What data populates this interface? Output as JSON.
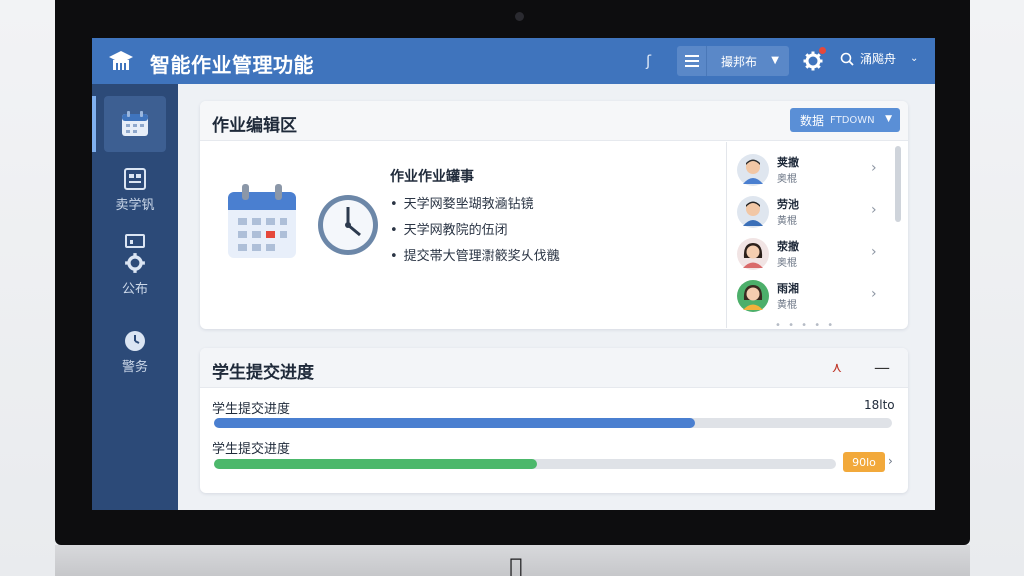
{
  "header": {
    "title": "智能作业管理功能",
    "separator_icon": "wave-icon",
    "filter_label": "撮邦布",
    "search_label": "涌飚舟",
    "accent_color": "#3f74bd"
  },
  "sidebar": {
    "items": [
      {
        "label": "",
        "icon": "calendar-icon"
      },
      {
        "label": "卖学钒",
        "icon": "grid-doc-icon"
      },
      {
        "label": "公布",
        "icon": "gear-icon"
      },
      {
        "label": "警务",
        "icon": "clock-icon"
      }
    ]
  },
  "editor": {
    "title": "作业编辑区",
    "data_button_label": "数据",
    "data_button_sub": "FTDOWN",
    "task_title": "作业作业罐事",
    "task_items": [
      "天学网婺㘴瑚㪍㴠钻镜",
      "天学网教院的伍闭",
      "提交帯大管理㵱䉰奖乆伐䰪"
    ],
    "students": [
      {
        "name": "荚撤",
        "sub": "奥棍"
      },
      {
        "name": "劳池",
        "sub": "黄棍"
      },
      {
        "name": "荥撤",
        "sub": "奥棍"
      },
      {
        "name": "雨湘",
        "sub": "黄棍"
      }
    ]
  },
  "progress": {
    "title": "学生提交进度",
    "rows": [
      {
        "label": "学生提交进度",
        "value_text": "18lto",
        "fraction": 0.71,
        "color": "#4a7fd0"
      },
      {
        "label": "学生提交进度",
        "value_text": "90lo",
        "fraction": 0.52,
        "color": "#4cb86b"
      }
    ]
  }
}
